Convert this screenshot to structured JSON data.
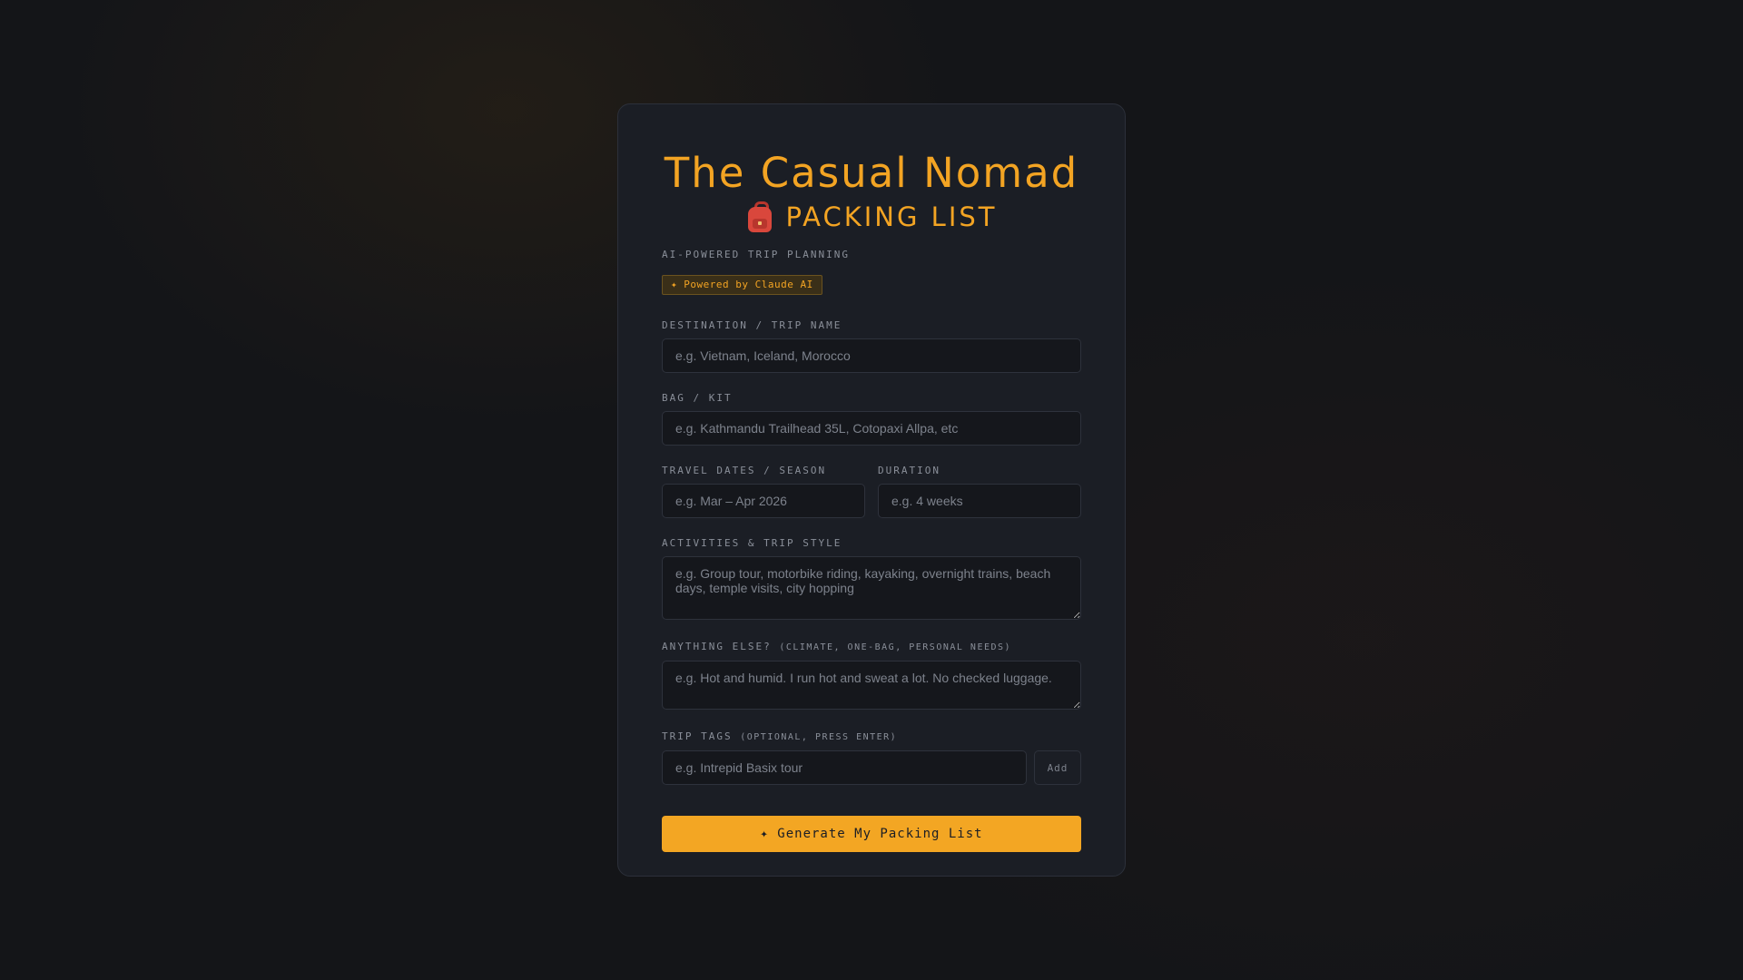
{
  "header": {
    "title": "The Casual Nomad",
    "subtitle": "PACKING LIST",
    "subtitle_icon": "backpack-icon",
    "tagline": "AI-POWERED TRIP PLANNING",
    "badge": "✦ Powered by Claude AI"
  },
  "form": {
    "destination": {
      "label": "DESTINATION / TRIP NAME",
      "placeholder": "e.g. Vietnam, Iceland, Morocco",
      "value": ""
    },
    "bag": {
      "label": "BAG / KIT",
      "placeholder": "e.g. Kathmandu Trailhead 35L, Cotopaxi Allpa, etc",
      "value": ""
    },
    "dates": {
      "label": "TRAVEL DATES / SEASON",
      "placeholder": "e.g. Mar – Apr 2026",
      "value": ""
    },
    "duration": {
      "label": "DURATION",
      "placeholder": "e.g. 4 weeks",
      "value": ""
    },
    "activities": {
      "label": "ACTIVITIES & TRIP STYLE",
      "placeholder": "e.g. Group tour, motorbike riding, kayaking, overnight trains, beach days, temple visits, city hopping",
      "value": ""
    },
    "notes": {
      "label": "ANYTHING ELSE?",
      "label_hint": "(CLIMATE, ONE-BAG, PERSONAL NEEDS)",
      "placeholder": "e.g. Hot and humid. I run hot and sweat a lot. No checked luggage.",
      "value": ""
    },
    "tags": {
      "label": "TRIP TAGS",
      "label_hint": "(OPTIONAL, PRESS ENTER)",
      "placeholder": "e.g. Intrepid Basix tour",
      "value": "",
      "add_label": "Add"
    },
    "generate_label": "✦ Generate My Packing List"
  },
  "colors": {
    "accent": "#f3a623",
    "background": "#141518",
    "card": "#1b1e25"
  }
}
